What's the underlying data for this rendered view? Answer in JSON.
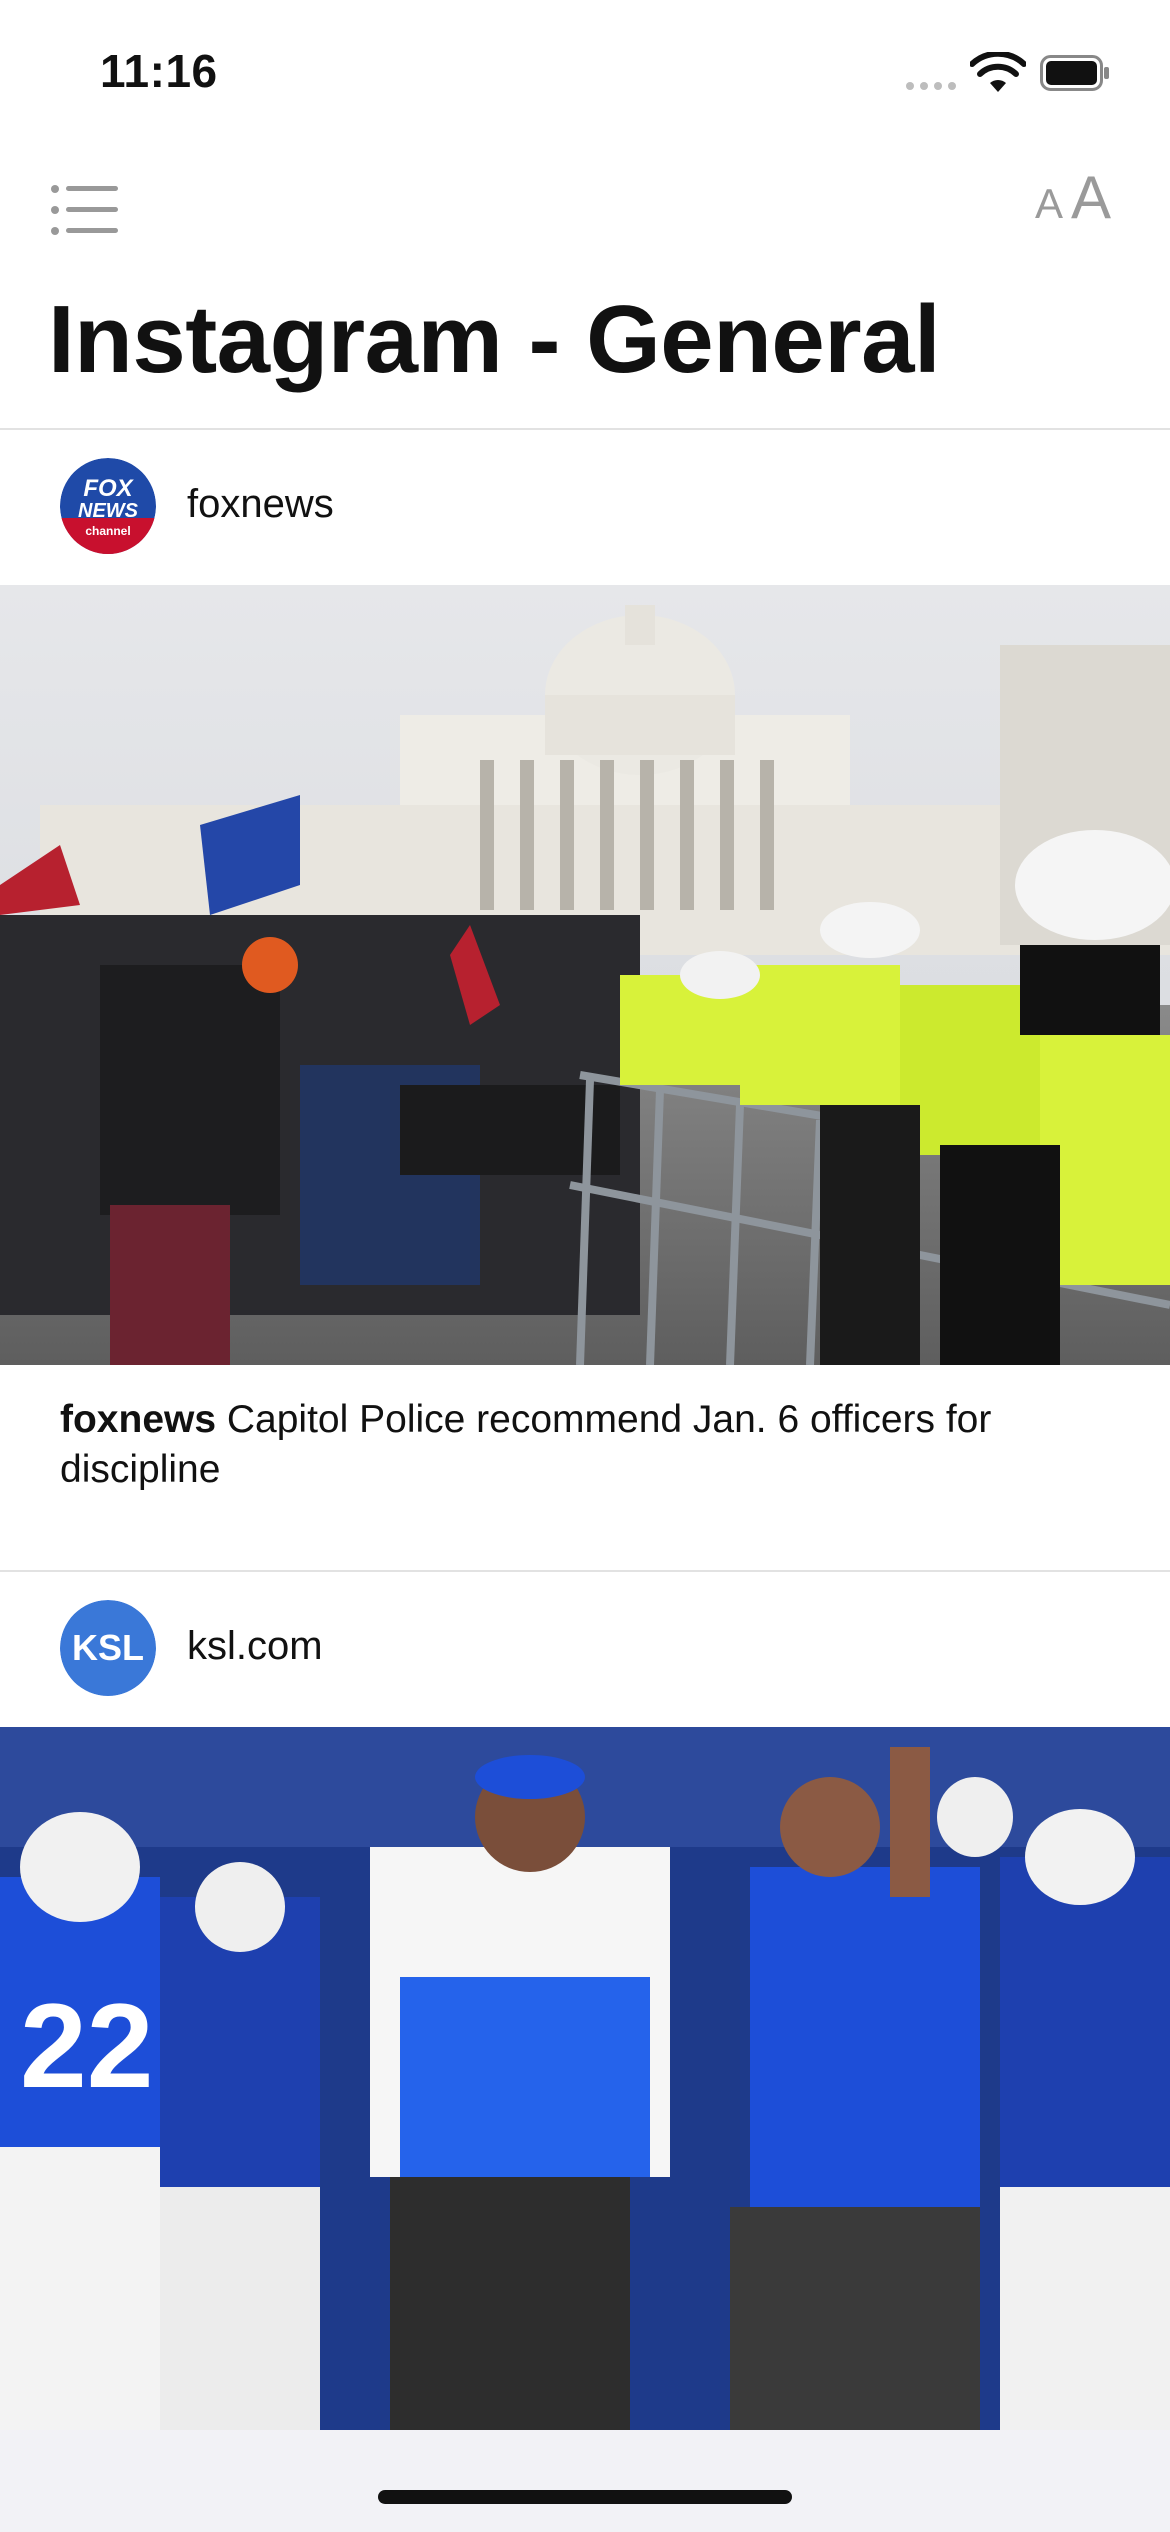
{
  "status_bar": {
    "time": "11:16"
  },
  "toolbar": {
    "menu_icon": "list-icon",
    "text_size_icon": "text-size-icon",
    "text_size_small": "A",
    "text_size_large": "A"
  },
  "page": {
    "title": "Instagram - General"
  },
  "posts": [
    {
      "username": "foxnews",
      "avatar_lines": [
        "FOX",
        "NEWS",
        "channel"
      ],
      "caption_user": "foxnews",
      "caption_text": " Capitol Police recommend Jan. 6 officers for discipline"
    },
    {
      "username": "ksl.com",
      "avatar_lines": [
        "KSL"
      ]
    }
  ],
  "colors": {
    "fox_blue": "#1f4aa8",
    "fox_red": "#c8102e",
    "ksl_blue": "#3a78d8",
    "police_yellow": "#d8f23a",
    "byu_blue": "#1d4ed8"
  }
}
